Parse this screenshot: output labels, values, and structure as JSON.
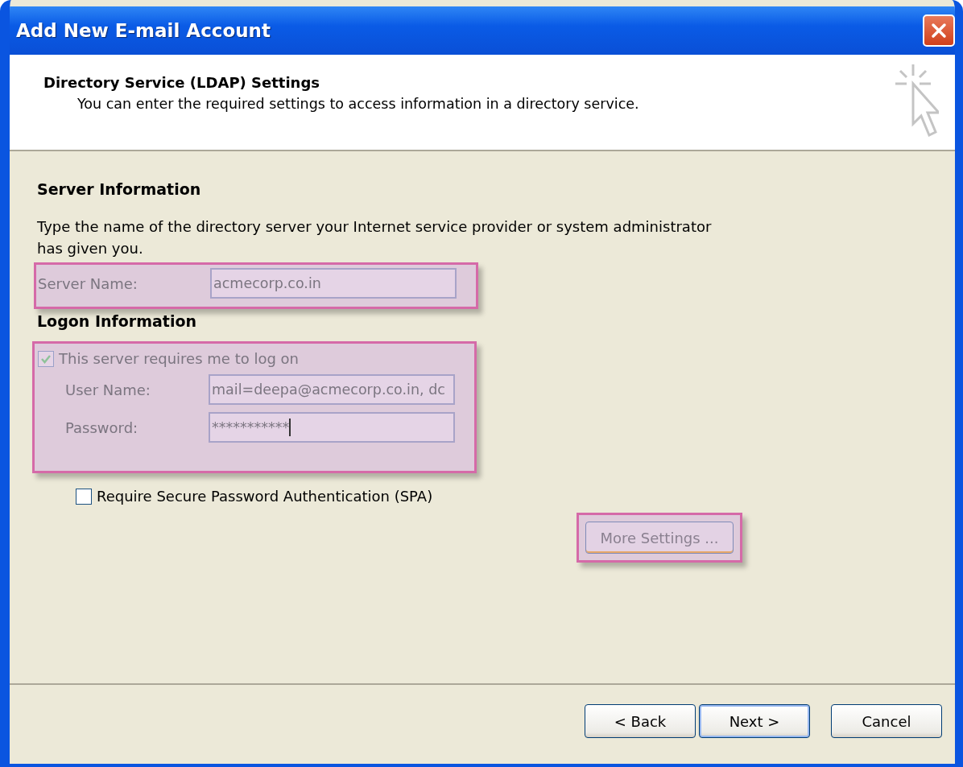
{
  "window": {
    "title": "Add New E-mail Account"
  },
  "header": {
    "title": "Directory Service (LDAP) Settings",
    "subtitle": "You can enter the required settings to access information in a directory service."
  },
  "server_section": {
    "heading": "Server Information",
    "description": "Type the name of the directory server your Internet service provider or system administrator has given you.",
    "highlighted": true,
    "server_name": {
      "label": "Server Name:",
      "value": "acmecorp.co.in"
    }
  },
  "logon_section": {
    "heading": "Logon Information",
    "highlighted": true,
    "requires_logon": {
      "label": "This server requires me to log on",
      "checked": true,
      "disabled": true
    },
    "user_name": {
      "label": "User Name:",
      "value": "mail=deepa@acmecorp.co.in, dc"
    },
    "password": {
      "label": "Password:",
      "value": "***********"
    }
  },
  "spa": {
    "label": "Require Secure Password Authentication (SPA)",
    "checked": false,
    "disabled": false
  },
  "more_settings": {
    "label": "More Settings ...",
    "highlighted": true
  },
  "buttons": [
    {
      "label": "< Back",
      "default": false
    },
    {
      "label": "Next >",
      "default": true
    },
    {
      "label": "Cancel",
      "default": false
    }
  ]
}
